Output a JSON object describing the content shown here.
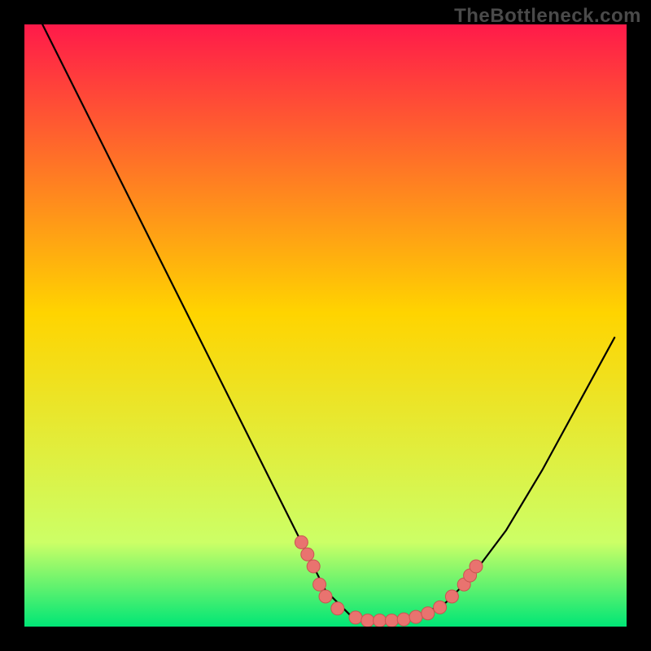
{
  "watermark": "TheBottleneck.com",
  "colors": {
    "bg": "#000000",
    "gradient_top": "#ff1a4a",
    "gradient_mid": "#ffd400",
    "gradient_low": "#ccff66",
    "gradient_bottom": "#00e676",
    "curve": "#000000",
    "marker_fill": "#e9736f",
    "marker_stroke": "#c95551"
  },
  "chart_data": {
    "type": "line",
    "title": "",
    "xlabel": "",
    "ylabel": "",
    "xlim": [
      0,
      100
    ],
    "ylim": [
      0,
      100
    ],
    "curve": [
      {
        "x": 3,
        "y": 100
      },
      {
        "x": 8,
        "y": 90
      },
      {
        "x": 15,
        "y": 76
      },
      {
        "x": 22,
        "y": 62
      },
      {
        "x": 29,
        "y": 48
      },
      {
        "x": 36,
        "y": 34
      },
      {
        "x": 42,
        "y": 22
      },
      {
        "x": 46,
        "y": 14
      },
      {
        "x": 50,
        "y": 6
      },
      {
        "x": 54,
        "y": 2
      },
      {
        "x": 58,
        "y": 1
      },
      {
        "x": 62,
        "y": 1
      },
      {
        "x": 66,
        "y": 2
      },
      {
        "x": 70,
        "y": 4
      },
      {
        "x": 74,
        "y": 8
      },
      {
        "x": 80,
        "y": 16
      },
      {
        "x": 86,
        "y": 26
      },
      {
        "x": 92,
        "y": 37
      },
      {
        "x": 98,
        "y": 48
      }
    ],
    "markers": [
      {
        "x": 46,
        "y": 14
      },
      {
        "x": 47,
        "y": 12
      },
      {
        "x": 48,
        "y": 10
      },
      {
        "x": 49,
        "y": 7
      },
      {
        "x": 50,
        "y": 5
      },
      {
        "x": 52,
        "y": 3
      },
      {
        "x": 55,
        "y": 1.5
      },
      {
        "x": 57,
        "y": 1
      },
      {
        "x": 59,
        "y": 1
      },
      {
        "x": 61,
        "y": 1
      },
      {
        "x": 63,
        "y": 1.2
      },
      {
        "x": 65,
        "y": 1.6
      },
      {
        "x": 67,
        "y": 2.2
      },
      {
        "x": 69,
        "y": 3.2
      },
      {
        "x": 71,
        "y": 5
      },
      {
        "x": 73,
        "y": 7
      },
      {
        "x": 74,
        "y": 8.5
      },
      {
        "x": 75,
        "y": 10
      }
    ]
  }
}
